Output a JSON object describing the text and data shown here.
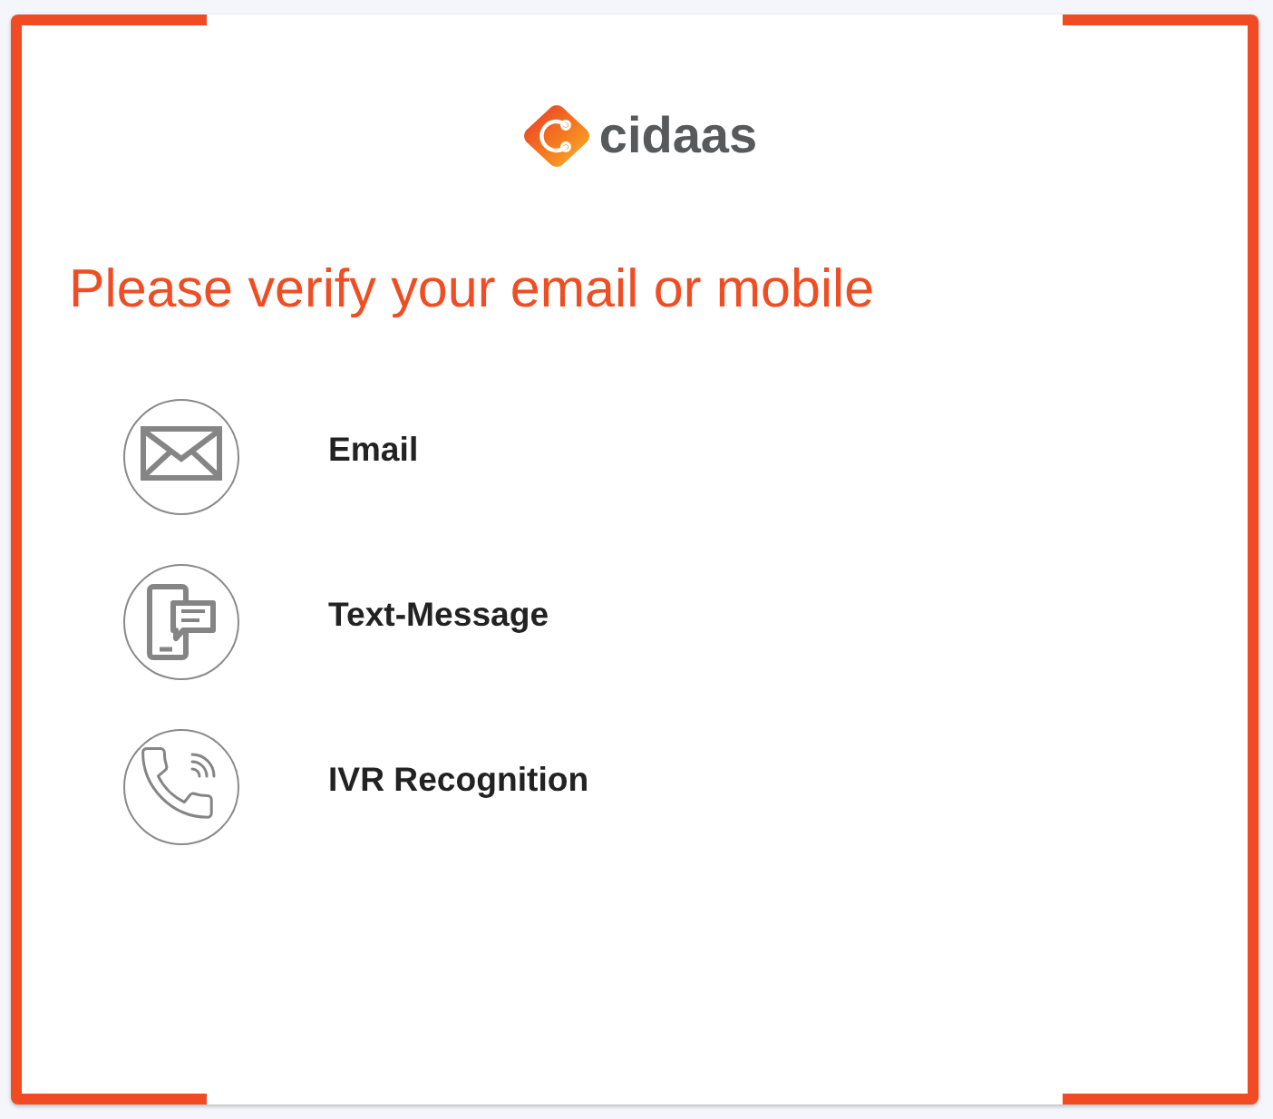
{
  "logo": {
    "text": "cidaas"
  },
  "title": "Please verify your email or mobile",
  "options": [
    {
      "kind": "email",
      "label": "Email"
    },
    {
      "kind": "sms",
      "label": "Text-Message"
    },
    {
      "kind": "ivr",
      "label": "IVR Recognition"
    }
  ]
}
